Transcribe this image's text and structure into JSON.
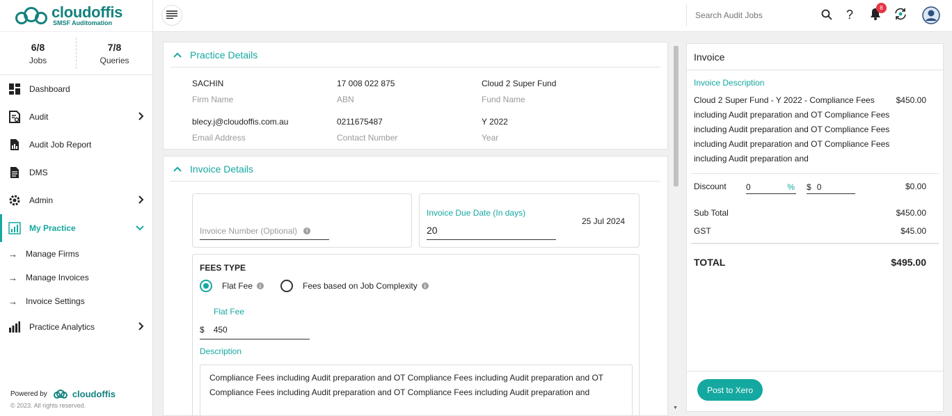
{
  "app": {
    "brand": "cloudoffis",
    "tagline": "SMSF Auditomation"
  },
  "stats": [
    {
      "value": "6/8",
      "label": "Jobs"
    },
    {
      "value": "7/8",
      "label": "Queries"
    }
  ],
  "nav": {
    "dashboard": "Dashboard",
    "audit": "Audit",
    "audit_job_report": "Audit Job Report",
    "dms": "DMS",
    "admin": "Admin",
    "my_practice": "My Practice",
    "manage_firms": "Manage Firms",
    "manage_invoices": "Manage Invoices",
    "invoice_settings": "Invoice Settings",
    "practice_analytics": "Practice Analytics"
  },
  "footer": {
    "powered_by": "Powered by",
    "brand": "cloudoffis",
    "copyright": "© 2023. All rights reserved."
  },
  "topbar": {
    "search_placeholder": "Search Audit Jobs",
    "notification_count": "8",
    "help": "?"
  },
  "practice": {
    "title": "Practice Details",
    "firm_name": {
      "value": "SACHIN",
      "label": "Firm Name"
    },
    "abn": {
      "value": "17 008 022 875",
      "label": "ABN"
    },
    "fund_name": {
      "value": "Cloud 2 Super Fund",
      "label": "Fund Name"
    },
    "email": {
      "value": "blecy.j@cloudoffis.com.au",
      "label": "Email Address"
    },
    "contact": {
      "value": "0211675487",
      "label": "Contact Number"
    },
    "year": {
      "value": "Y 2022",
      "label": "Year"
    }
  },
  "invoice_details": {
    "title": "Invoice Details",
    "invoice_number_placeholder": "Invoice Number (Optional)",
    "due_label": "Invoice Due Date (In days)",
    "due_value": "20",
    "due_date": "25 Jul 2024",
    "fees_type_label": "FEES TYPE",
    "flat_fee_option": "Flat Fee",
    "complexity_option": "Fees based on Job Complexity",
    "flat_fee_label": "Flat Fee",
    "currency": "$",
    "flat_fee_value": "450",
    "description_label": "Description",
    "description_line1": "Compliance Fees including Audit preparation and OT Compliance Fees including Audit preparation and OT",
    "description_line2": "Compliance Fees including Audit preparation and OT Compliance Fees including Audit preparation and"
  },
  "invoice": {
    "title": "Invoice",
    "desc_label": "Invoice Description",
    "desc_lines": [
      "Cloud 2 Super Fund - Y 2022 - Compliance Fees",
      "including Audit preparation and OT Compliance Fees",
      "including Audit preparation and OT Compliance Fees",
      "including Audit preparation and OT Compliance Fees",
      "including Audit preparation and"
    ],
    "line_amount": "$450.00",
    "discount_label": "Discount",
    "discount_percent": "0",
    "percent_sign": "%",
    "dollar_sign": "$",
    "discount_amount_input": "0",
    "discount_total": "$0.00",
    "subtotal_label": "Sub Total",
    "subtotal": "$450.00",
    "gst_label": "GST",
    "gst": "$45.00",
    "total_label": "TOTAL",
    "total": "$495.00",
    "post_button": "Post to Xero"
  },
  "colors": {
    "accent": "#14a8a0",
    "brand": "#13817d",
    "badge": "#e53545"
  }
}
